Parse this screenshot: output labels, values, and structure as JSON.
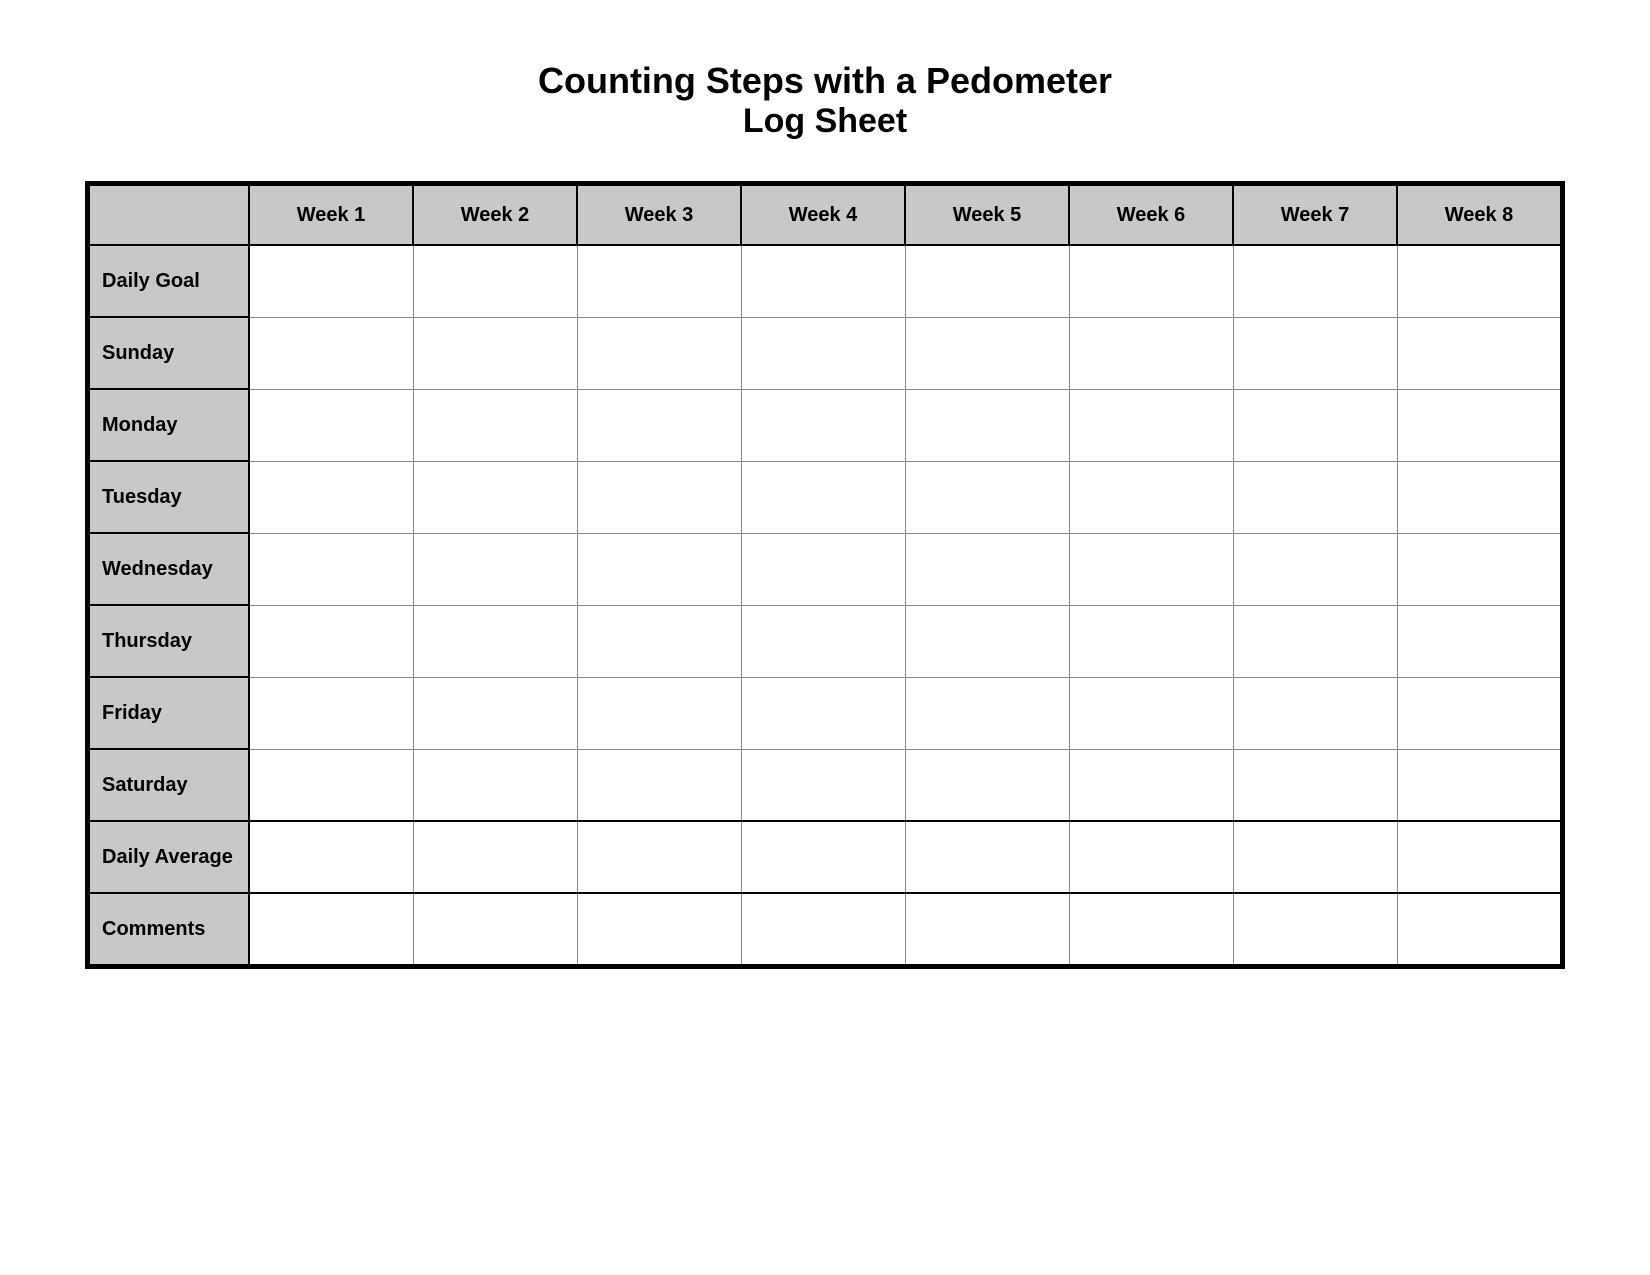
{
  "title": {
    "line1": "Counting Steps with a Pedometer",
    "line2": "Log Sheet"
  },
  "table": {
    "header": {
      "label_col": "",
      "weeks": [
        "Week 1",
        "Week 2",
        "Week 3",
        "Week 4",
        "Week 5",
        "Week 6",
        "Week 7",
        "Week 8"
      ]
    },
    "rows": [
      {
        "label": "Daily Goal"
      },
      {
        "label": "Sunday"
      },
      {
        "label": "Monday"
      },
      {
        "label": "Tuesday"
      },
      {
        "label": "Wednesday"
      },
      {
        "label": "Thursday"
      },
      {
        "label": "Friday"
      },
      {
        "label": "Saturday"
      },
      {
        "label": "Daily Average",
        "class": "row-daily-average"
      },
      {
        "label": "Comments",
        "class": "row-comments"
      }
    ]
  }
}
